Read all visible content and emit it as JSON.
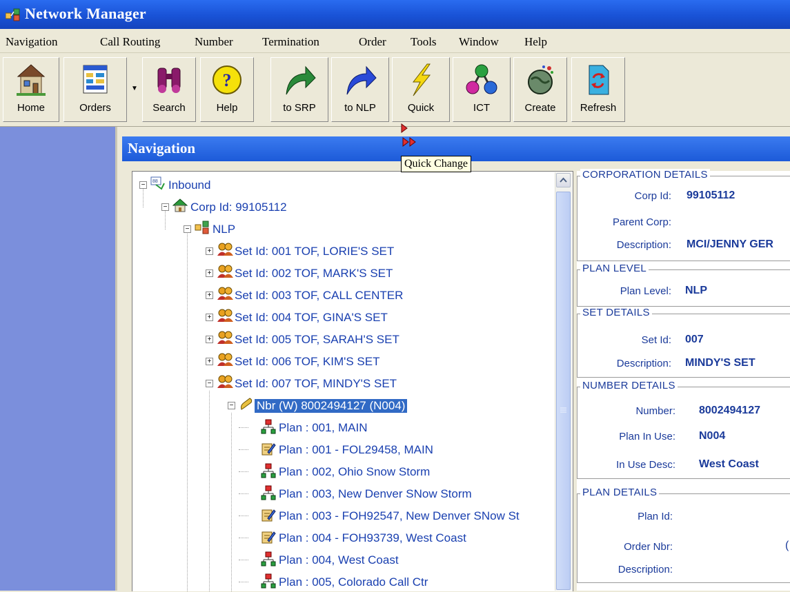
{
  "window": {
    "title": "Network Manager"
  },
  "menu": [
    "Navigation",
    "Call Routing",
    "Number",
    "Termination",
    "Order",
    "Tools",
    "Window",
    "Help"
  ],
  "toolbar": {
    "home": "Home",
    "orders": "Orders",
    "search": "Search",
    "help": "Help",
    "to_srp": "to SRP",
    "to_nlp": "to NLP",
    "quick": "Quick",
    "ict": "ICT",
    "create": "Create",
    "refresh": "Refresh"
  },
  "tooltip": "Quick Change",
  "navigation": {
    "title": "Navigation",
    "tree": [
      {
        "text": "Inbound",
        "icon": "inbound-icon",
        "expander": "−"
      },
      {
        "text": "Corp Id: 99105112",
        "icon": "corp-icon",
        "expander": "−"
      },
      {
        "text": "NLP",
        "icon": "nlp-icon",
        "expander": "−"
      },
      {
        "text": "Set Id:  001 TOF, LORIE'S SET",
        "icon": "people-icon",
        "expander": "+"
      },
      {
        "text": "Set Id:  002 TOF, MARK'S SET",
        "icon": "people-icon",
        "expander": "+"
      },
      {
        "text": "Set Id:  003 TOF, CALL CENTER",
        "icon": "people-icon",
        "expander": "+"
      },
      {
        "text": "Set Id:  004 TOF, GINA'S SET",
        "icon": "people-icon",
        "expander": "+"
      },
      {
        "text": "Set Id:  005 TOF, SARAH'S SET",
        "icon": "people-icon",
        "expander": "+"
      },
      {
        "text": "Set Id:  006 TOF, KIM'S SET",
        "icon": "people-icon",
        "expander": "+"
      },
      {
        "text": "Set Id:  007 TOF, MINDY'S SET",
        "icon": "people-icon",
        "expander": "−"
      },
      {
        "text": "Nbr (W) 8002494127 (N004)",
        "icon": "phone-icon",
        "expander": "−",
        "selected": true
      },
      {
        "text": "Plan : 001, MAIN",
        "icon": "plan-tree-icon"
      },
      {
        "text": "Plan : 001 - FOL29458, MAIN",
        "icon": "plan-edit-icon"
      },
      {
        "text": "Plan : 002, Ohio Snow Storm",
        "icon": "plan-tree-icon"
      },
      {
        "text": "Plan : 003, New Denver SNow Storm",
        "icon": "plan-tree-icon"
      },
      {
        "text": "Plan : 003 - FOH92547, New Denver SNow St",
        "icon": "plan-edit-icon"
      },
      {
        "text": "Plan : 004 - FOH93739, West Coast",
        "icon": "plan-edit-icon"
      },
      {
        "text": "Plan : 004, West Coast",
        "icon": "plan-tree-icon"
      },
      {
        "text": "Plan : 005, Colorado Call Ctr",
        "icon": "plan-tree-icon"
      }
    ]
  },
  "details": {
    "corporation": {
      "title": "CORPORATION DETAILS",
      "corp_id_label": "Corp Id:",
      "corp_id": "99105112",
      "parent_label": "Parent Corp:",
      "parent": "",
      "desc_label": "Description:",
      "desc": "MCI/JENNY GER"
    },
    "plan_level": {
      "title": "PLAN LEVEL",
      "label": "Plan Level:",
      "value": "NLP"
    },
    "set": {
      "title": "SET DETAILS",
      "set_id_label": "Set Id:",
      "set_id": "007",
      "desc_label": "Description:",
      "desc": "MINDY'S SET"
    },
    "number": {
      "title": "NUMBER DETAILS",
      "number_label": "Number:",
      "number": "8002494127",
      "plan_in_use_label": "Plan In Use:",
      "plan_in_use": "N004",
      "in_use_desc_label": "In Use Desc:",
      "in_use_desc": "West Coast"
    },
    "plan": {
      "title": "PLAN DETAILS",
      "plan_id_label": "Plan Id:",
      "plan_id": "",
      "order_nbr_label": "Order Nbr:",
      "order_nbr": "(",
      "desc_label": "Description:",
      "desc": ""
    }
  },
  "colors": {
    "title_bar": "#1952d6",
    "left_panel": "#7b8fdc",
    "selection": "#316ac5",
    "tree_text": "#1a40b0"
  }
}
